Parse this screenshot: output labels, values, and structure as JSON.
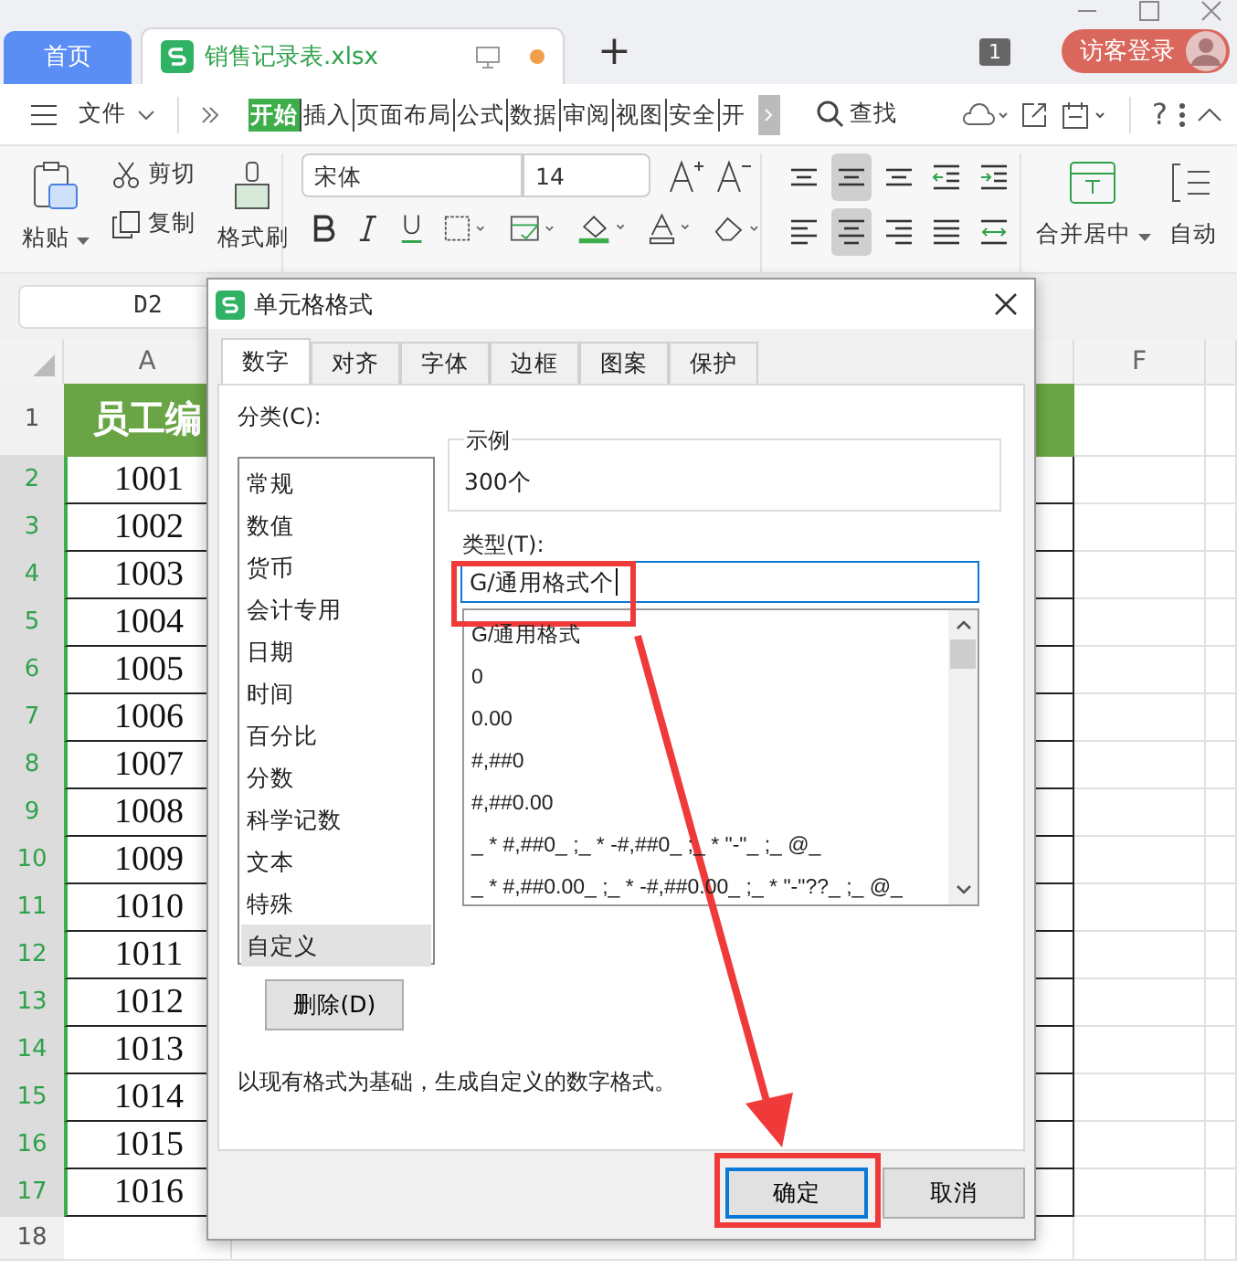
{
  "tabs": [
    {
      "label": "首页",
      "kind": "home",
      "selected": false
    },
    {
      "label": "销售记录表.xlsx",
      "kind": "file",
      "selected": true
    }
  ],
  "new_tab": "+",
  "window_count": "1",
  "login_button": "访客登录",
  "menu": {
    "file": "文件",
    "tabs": [
      {
        "label": "开始",
        "selected": true
      },
      {
        "label": "插入",
        "selected": false
      },
      {
        "label": "页面布局",
        "selected": false
      },
      {
        "label": "公式",
        "selected": false
      },
      {
        "label": "数据",
        "selected": false
      },
      {
        "label": "审阅",
        "selected": false
      },
      {
        "label": "视图",
        "selected": false
      },
      {
        "label": "安全",
        "selected": false
      },
      {
        "label": "开",
        "selected": false
      }
    ],
    "search": "查找",
    "help": "?"
  },
  "ribbon": {
    "paste": "粘贴",
    "cut": "剪切",
    "copy": "复制",
    "format_painter": "格式刷",
    "font": "宋体",
    "size": "14",
    "merge": "合并居中",
    "wrap": "自动",
    "align_buttons": [
      {
        "kind": "top",
        "selected": false
      },
      {
        "kind": "middle",
        "selected": true
      },
      {
        "kind": "bottom",
        "selected": false
      },
      {
        "kind": "outdent",
        "selected": false
      },
      {
        "kind": "indent",
        "selected": false
      },
      {
        "kind": "left",
        "selected": false
      },
      {
        "kind": "center",
        "selected": true
      },
      {
        "kind": "right",
        "selected": false
      },
      {
        "kind": "justify",
        "selected": false
      },
      {
        "kind": "distribute",
        "selected": false
      }
    ]
  },
  "name_box": "D2",
  "sheet": {
    "columns": [
      "A",
      "F"
    ],
    "rows": [
      {
        "number": "1",
        "value": "员工编",
        "kind": "header",
        "selected": false
      },
      {
        "number": "2",
        "value": "1001",
        "selected": true
      },
      {
        "number": "3",
        "value": "1002",
        "selected": true
      },
      {
        "number": "4",
        "value": "1003",
        "selected": true
      },
      {
        "number": "5",
        "value": "1004",
        "selected": true
      },
      {
        "number": "6",
        "value": "1005",
        "selected": true
      },
      {
        "number": "7",
        "value": "1006",
        "selected": true
      },
      {
        "number": "8",
        "value": "1007",
        "selected": true
      },
      {
        "number": "9",
        "value": "1008",
        "selected": true
      },
      {
        "number": "10",
        "value": "1009",
        "selected": true
      },
      {
        "number": "11",
        "value": "1010",
        "selected": true
      },
      {
        "number": "12",
        "value": "1011",
        "selected": true
      },
      {
        "number": "13",
        "value": "1012",
        "selected": true
      },
      {
        "number": "14",
        "value": "1013",
        "selected": true
      },
      {
        "number": "15",
        "value": "1014",
        "selected": true
      },
      {
        "number": "16",
        "value": "1015",
        "selected": true
      },
      {
        "number": "17",
        "value": "1016",
        "selected": true
      },
      {
        "number": "18",
        "kind": "empty",
        "selected": false
      }
    ]
  },
  "dialog": {
    "title": "单元格格式",
    "tabs": [
      {
        "label": "数字",
        "selected": true
      },
      {
        "label": "对齐",
        "selected": false
      },
      {
        "label": "字体",
        "selected": false
      },
      {
        "label": "边框",
        "selected": false
      },
      {
        "label": "图案",
        "selected": false
      },
      {
        "label": "保护",
        "selected": false
      }
    ],
    "category_label": "分类(C):",
    "categories": [
      {
        "label": "常规",
        "selected": false
      },
      {
        "label": "数值",
        "selected": false
      },
      {
        "label": "货币",
        "selected": false
      },
      {
        "label": "会计专用",
        "selected": false
      },
      {
        "label": "日期",
        "selected": false
      },
      {
        "label": "时间",
        "selected": false
      },
      {
        "label": "百分比",
        "selected": false
      },
      {
        "label": "分数",
        "selected": false
      },
      {
        "label": "科学记数",
        "selected": false
      },
      {
        "label": "文本",
        "selected": false
      },
      {
        "label": "特殊",
        "selected": false
      },
      {
        "label": "自定义",
        "selected": true
      }
    ],
    "sample_label": "示例",
    "sample": "300个",
    "type_label": "类型(T):",
    "type_value": "G/通用格式个",
    "formats": [
      "G/通用格式",
      "0",
      "0.00",
      "#,##0",
      "#,##0.00",
      "_ * #,##0_ ;_ * -#,##0_ ;_ * \"-\"_ ;_ @_",
      "_ * #,##0.00_ ;_ * -#,##0.00_ ;_ * \"-\"??_ ;_ @_"
    ],
    "delete_button": "删除(D)",
    "description": "以现有格式为基础，生成自定义的数字格式。",
    "ok": "确定",
    "cancel": "取消"
  }
}
